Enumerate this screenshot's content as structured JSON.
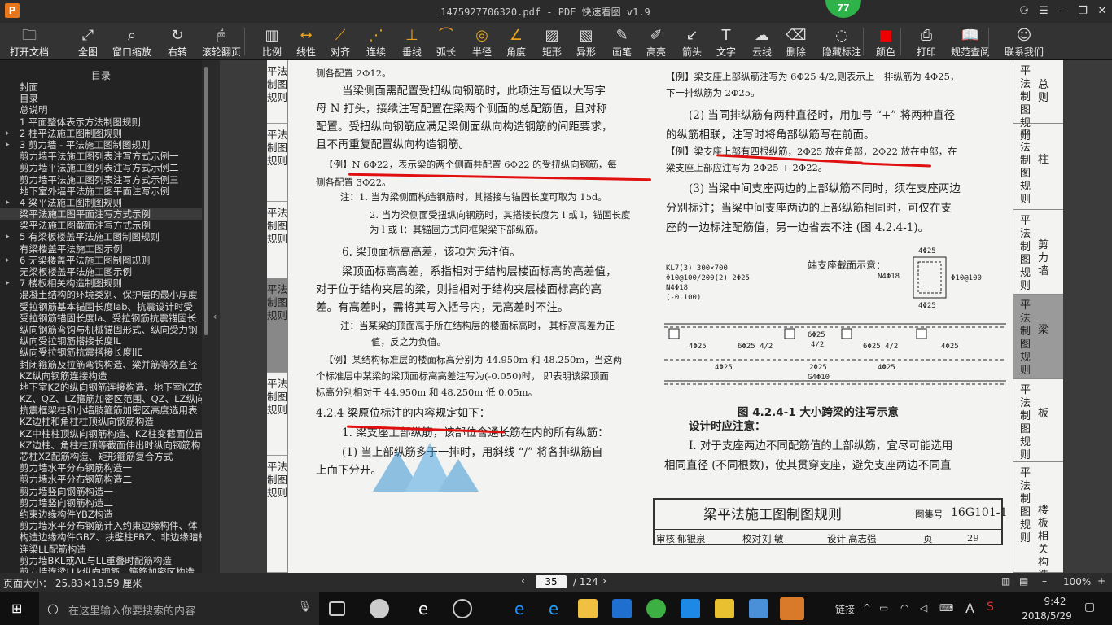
{
  "window": {
    "title": "1475927706320.pdf - PDF 快速看图 v1.9",
    "logo": "P",
    "badge": "77"
  },
  "toolbar": [
    {
      "label": "打开文档",
      "icon": "folder-icon",
      "glyph": "🗀"
    },
    {
      "label": "全图",
      "icon": "fit-icon",
      "glyph": "⤢"
    },
    {
      "label": "窗口缩放",
      "icon": "zoom-icon",
      "glyph": "⌕"
    },
    {
      "label": "右转",
      "icon": "rotate-right-icon",
      "glyph": "↻"
    },
    {
      "label": "滚轮翻页",
      "icon": "mouse-icon",
      "glyph": "🖱"
    },
    {
      "label": "比例",
      "icon": "scale-icon",
      "glyph": "▥"
    },
    {
      "label": "线性",
      "icon": "linear-icon",
      "glyph": "↔"
    },
    {
      "label": "对齐",
      "icon": "align-icon",
      "glyph": "⟋"
    },
    {
      "label": "连续",
      "icon": "continuous-icon",
      "glyph": "⋰"
    },
    {
      "label": "垂线",
      "icon": "perpendicular-icon",
      "glyph": "⊥"
    },
    {
      "label": "弧长",
      "icon": "arc-icon",
      "glyph": "⌒"
    },
    {
      "label": "半径",
      "icon": "radius-icon",
      "glyph": "◎"
    },
    {
      "label": "角度",
      "icon": "angle-icon",
      "glyph": "∠"
    },
    {
      "label": "矩形",
      "icon": "rectangle-icon",
      "glyph": "▨"
    },
    {
      "label": "异形",
      "icon": "polygon-icon",
      "glyph": "▧"
    },
    {
      "label": "画笔",
      "icon": "pen-icon",
      "glyph": "✎"
    },
    {
      "label": "高亮",
      "icon": "highlight-icon",
      "glyph": "✐"
    },
    {
      "label": "箭头",
      "icon": "arrow-icon",
      "glyph": "↙"
    },
    {
      "label": "文字",
      "icon": "text-icon",
      "glyph": "T"
    },
    {
      "label": "云线",
      "icon": "cloud-icon",
      "glyph": "☁"
    },
    {
      "label": "删除",
      "icon": "eraser-icon",
      "glyph": "⌫"
    },
    {
      "label": "隐藏标注",
      "icon": "hide-icon",
      "glyph": "◌"
    },
    {
      "label": "颜色",
      "icon": "color-icon",
      "glyph": "■"
    },
    {
      "label": "打印",
      "icon": "print-icon",
      "glyph": "⎙"
    },
    {
      "label": "规范查阅",
      "icon": "book-icon",
      "glyph": "📖"
    },
    {
      "label": "联系我们",
      "icon": "contact-icon",
      "glyph": "☺"
    }
  ],
  "sidebar": {
    "heading": "目录",
    "items": [
      {
        "label": "封面",
        "arrow": ""
      },
      {
        "label": "目录",
        "arrow": ""
      },
      {
        "label": "总说明",
        "arrow": ""
      },
      {
        "label": "1 平面整体表示方法制图规则",
        "arrow": ""
      },
      {
        "label": "2 柱平法施工图制图规则",
        "arrow": "▸"
      },
      {
        "label": "3 剪力墙 - 平法施工图制图规则",
        "arrow": "▸"
      },
      {
        "label": "剪力墙平法施工图列表注写方式示例一",
        "arrow": ""
      },
      {
        "label": "剪力墙平法施工图列表注写方式示例二",
        "arrow": ""
      },
      {
        "label": "剪力墙平法施工图列表注写方式示例三",
        "arrow": ""
      },
      {
        "label": "地下室外墙平法施工图平面注写示例",
        "arrow": ""
      },
      {
        "label": "4 梁平法施工图制图规则",
        "arrow": "▸"
      },
      {
        "label": "梁平法施工图平面注写方式示例",
        "arrow": "",
        "sel": true
      },
      {
        "label": "梁平法施工图截面注写方式示例",
        "arrow": ""
      },
      {
        "label": "5 有梁板楼盖平法施工图制图规则",
        "arrow": "▸"
      },
      {
        "label": "有梁楼盖平法施工图示例",
        "arrow": ""
      },
      {
        "label": "6 无梁楼盖平法施工图制图规则",
        "arrow": "▸"
      },
      {
        "label": "无梁板楼盖平法施工图示例",
        "arrow": ""
      },
      {
        "label": "7 楼板相关构造制图规则",
        "arrow": "▸"
      },
      {
        "label": "混凝土结构的环境类别、保护层的最小厚度",
        "arrow": ""
      },
      {
        "label": "受拉钢筋基本锚固长度lab、抗震设计时受",
        "arrow": ""
      },
      {
        "label": "受拉钢筋锚固长度la、受拉钢筋抗震锚固长",
        "arrow": ""
      },
      {
        "label": "纵向钢筋弯钩与机械锚固形式、纵向受力钢",
        "arrow": ""
      },
      {
        "label": "纵向受拉钢筋搭接长度lL",
        "arrow": ""
      },
      {
        "label": "纵向受拉钢筋抗震搭接长度llE",
        "arrow": ""
      },
      {
        "label": "封闭箍筋及拉筋弯钩构造、梁并筋等效直径",
        "arrow": ""
      },
      {
        "label": "KZ纵向钢筋连接构造",
        "arrow": ""
      },
      {
        "label": "地下室KZ的纵向钢筋连接构造、地下室KZ的",
        "arrow": ""
      },
      {
        "label": "KZ、QZ、LZ箍筋加密区范围、QZ、LZ纵向钢",
        "arrow": ""
      },
      {
        "label": "抗震框架柱和小墙肢箍筋加密区高度选用表",
        "arrow": ""
      },
      {
        "label": "KZ边柱和角柱柱顶纵向钢筋构造",
        "arrow": ""
      },
      {
        "label": "KZ中柱柱顶纵向钢筋构造、KZ柱变截面位置",
        "arrow": ""
      },
      {
        "label": "KZ边柱、角柱柱顶等截面伸出时纵向钢筋构",
        "arrow": ""
      },
      {
        "label": "芯柱XZ配筋构造、矩形箍筋复合方式",
        "arrow": ""
      },
      {
        "label": "剪力墙水平分布钢筋构造一",
        "arrow": ""
      },
      {
        "label": "剪力墙水平分布钢筋构造二",
        "arrow": ""
      },
      {
        "label": "剪力墙竖向钢筋构造一",
        "arrow": ""
      },
      {
        "label": "剪力墙竖向钢筋构造二",
        "arrow": ""
      },
      {
        "label": "约束边缘构件YBZ构造",
        "arrow": ""
      },
      {
        "label": "剪力墙水平分布钢筋计入约束边缘构件、体",
        "arrow": ""
      },
      {
        "label": "构造边缘构件GBZ、扶壁柱FBZ、非边缘暗柱",
        "arrow": ""
      },
      {
        "label": "连梁LL配筋构造",
        "arrow": ""
      },
      {
        "label": "剪力墙BKL或AL与LL重叠时配筋构造",
        "arrow": ""
      },
      {
        "label": "剪力墙连梁LLk纵向钢筋、箍筋加密区构造",
        "arrow": ""
      }
    ]
  },
  "page": {
    "left_tabs": [
      "平法制图规则",
      "平法制图规则",
      "平法制图规则",
      "平法制图规则",
      "平法制图规则",
      "平法制图规则"
    ],
    "right_tabs": [
      {
        "v": "平法制图规则",
        "n": "总则"
      },
      {
        "v": "平法制图规则",
        "n": "柱"
      },
      {
        "v": "平法制图规则",
        "n": "剪力墙"
      },
      {
        "v": "平法制图规则",
        "n": "梁"
      },
      {
        "v": "平法制图规则",
        "n": "板"
      },
      {
        "v": "平法制图规则",
        "n": "楼板相关构造"
      }
    ],
    "left_col": [
      "侧各配置 2Φ12。",
      "当梁侧面需配置受扭纵向钢筋时，此项注写值以大写字",
      "母 N 打头，接续注写配置在梁两个侧面的总配筋值，且对称",
      "配置。受扭纵向钢筋应满足梁侧面纵向构造钢筋的间距要求，",
      "且不再重复配置纵向构造钢筋。",
      "【例】N 6Φ22，表示梁的两个侧面共配置 6Φ22 的受扭纵向钢筋，每",
      "侧各配置 3Φ22。",
      "注：1. 当为梁侧面构造钢筋时，其搭接与锚固长度可取为 15d。",
      "2. 当为梁侧面受扭纵向钢筋时，其搭接长度为 l 或 l，锚固长度",
      "为 l 或 l：其锚固方式同框架梁下部纵筋。",
      "6. 梁顶面标高高差，该项为选注值。",
      "梁顶面标高高差，系指相对于结构层楼面标高的高差值，",
      "对于位于结构夹层的梁，则指相对于结构夹层楼面标高的高",
      "差。有高差时，需将其写入括号内，无高差时不注。",
      "注：当某梁的顶面高于所在结构层的楼面标高时， 其标高高差为正",
      "值，反之为负值。",
      "【例】某结构标准层的楼面标高分别为 44.950m 和 48.250m，当这两",
      "个标准层中某梁的梁顶面标高高差注写为(-0.050)时， 即表明该梁顶面",
      "标高分别相对于 44.950m 和 48.250m 低 0.05m。",
      "4.2.4  梁原位标注的内容规定如下：",
      "1. 梁支座上部纵筋，该部位含通长筋在内的所有纵筋：",
      "(1) 当上部纵筋多于一排时，用斜线 “/” 将各排纵筋自",
      "上而下分开。"
    ],
    "right_col": [
      "【例】梁支座上部纵筋注写为 6Φ25 4/2,则表示上一排纵筋为 4Φ25，",
      "下一排纵筋为 2Φ25。",
      "(2) 当同排纵筋有两种直径时，用加号 “+” 将两种直径",
      "的纵筋相联，注写时将角部纵筋写在前面。",
      "【例】梁支座上部有四根纵筋，2Φ25 放在角部，2Φ22 放在中部，在",
      "梁支座上部应注写为 2Φ25 + 2Φ22。",
      "(3) 当梁中间支座两边的上部纵筋不同时，须在支座两边",
      "分别标注；当梁中间支座两边的上部纵筋相同时，可仅在支",
      "座的一边标注配筋值，另一边省去不注 (图 4.2.4-1)。",
      "设计时应注意：",
      "Ⅰ. 对于支座两边不同配筋值的上部纵筋，宜尽可能选用",
      "相同直径 (不同根数)，使其贯穿支座，避免支座两边不同直"
    ],
    "diagram": {
      "beam_label": "KL7(3)  300×700",
      "stirrup": "Φ10@100/200(2)  2Φ25",
      "torsion": "N4Φ18",
      "elev": "(-0.100)",
      "section_title": "端支座截面示意：",
      "sec_top": "4Φ25",
      "sec_side": "N4Φ18",
      "sec_stir": "Φ10@100",
      "sec_bot": "4Φ25",
      "top1": "4Φ25",
      "top2": "6Φ25  4/2",
      "mid_a": "6Φ25",
      "mid_b": "4/2",
      "top3": "6Φ25  4/2",
      "top4": "4Φ25",
      "bot1": "4Φ25",
      "bot2": "4Φ25",
      "mid_c": "2Φ25",
      "mid_d": "G4Φ10"
    },
    "caption": "图 4.2.4-1  大小跨梁的注写示意",
    "title_block": {
      "title": "梁平法施工图制图规则",
      "atlas_label": "图集号",
      "atlas": "16G101-1",
      "review_label": "审核",
      "reviewer": "郁银泉",
      "check_label": "校对",
      "checker": "刘   敏",
      "design_label": "设计",
      "designer": "高志强",
      "page_label": "页",
      "page_no": "29"
    }
  },
  "statusbar": {
    "size": "页面大小： 25.83×18.59 厘米",
    "page_current": "35",
    "page_total": "/ 124",
    "zoom": "100%"
  },
  "taskbar": {
    "search_placeholder": "在这里输入你要搜索的内容",
    "link": "链接",
    "time": "9:42",
    "date": "2018/5/29",
    "input_lang": "A"
  }
}
